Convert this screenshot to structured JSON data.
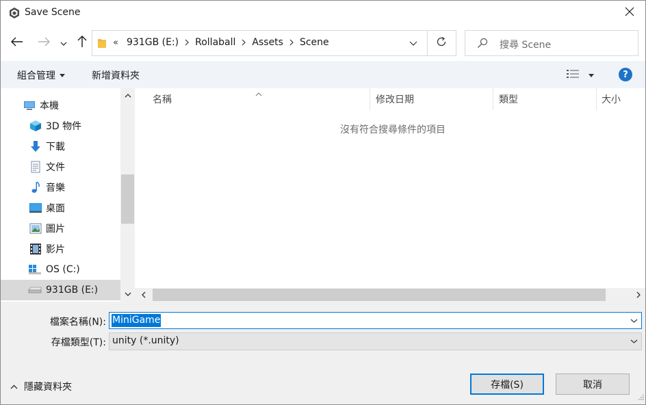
{
  "window": {
    "title": "Save Scene",
    "close_glyph": "✕"
  },
  "nav": {
    "back_icon": "arrow-left-icon",
    "forward_icon": "arrow-right-icon",
    "recent_icon": "chevron-down-icon",
    "up_icon": "arrow-up-icon"
  },
  "address": {
    "overflow": "«",
    "crumbs": [
      "931GB (E:)",
      "Rollaball",
      "Assets",
      "Scene"
    ]
  },
  "search": {
    "placeholder": "搜尋 Scene"
  },
  "toolbar": {
    "organize_label": "組合管理",
    "new_folder_label": "新增資料夾",
    "help_label": "?"
  },
  "navpane": {
    "items": [
      {
        "label": "本機",
        "icon": "computer-icon"
      },
      {
        "label": "3D 物件",
        "icon": "3d-objects-icon"
      },
      {
        "label": "下載",
        "icon": "download-icon"
      },
      {
        "label": "文件",
        "icon": "documents-icon"
      },
      {
        "label": "音樂",
        "icon": "music-icon"
      },
      {
        "label": "桌面",
        "icon": "desktop-icon"
      },
      {
        "label": "圖片",
        "icon": "pictures-icon"
      },
      {
        "label": "影片",
        "icon": "videos-icon"
      },
      {
        "label": "OS (C:)",
        "icon": "windows-drive-icon"
      },
      {
        "label": "931GB (E:)",
        "icon": "drive-icon",
        "selected": true
      }
    ]
  },
  "filelist": {
    "columns": [
      "名稱",
      "修改日期",
      "類型",
      "大小"
    ],
    "empty_message": "沒有符合搜尋條件的項目"
  },
  "form": {
    "filename_label": "檔案名稱(N):",
    "filename_value": "MiniGame",
    "filetype_label": "存檔類型(T):",
    "filetype_value": "unity (*.unity)"
  },
  "footer": {
    "hide_folders_label": "隱藏資料夾",
    "save_label": "存檔(S)",
    "cancel_label": "取消"
  },
  "colors": {
    "accent": "#0078d7",
    "toolbar_bg": "#f0f4f9",
    "selected_bg": "#d9d9d9"
  }
}
